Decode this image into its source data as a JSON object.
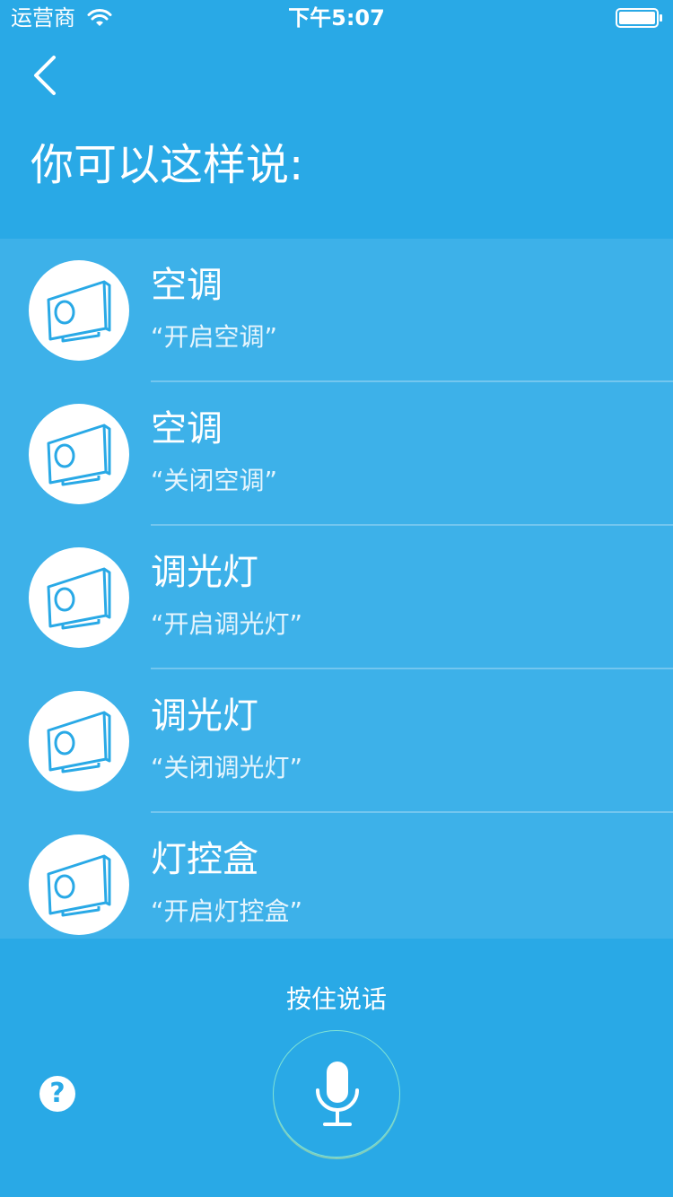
{
  "status_bar": {
    "carrier": "运营商",
    "time": "下午5:07"
  },
  "header": {
    "title": "你可以这样说:"
  },
  "commands": [
    {
      "device": "空调",
      "phrase": "“开启空调”",
      "icon": "device-box-icon"
    },
    {
      "device": "空调",
      "phrase": "“关闭空调”",
      "icon": "device-box-icon"
    },
    {
      "device": "调光灯",
      "phrase": "“开启调光灯”",
      "icon": "device-box-icon"
    },
    {
      "device": "调光灯",
      "phrase": "“关闭调光灯”",
      "icon": "device-box-icon"
    },
    {
      "device": "灯控盒",
      "phrase": "“开启灯控盒”",
      "icon": "device-box-icon"
    }
  ],
  "footer": {
    "hold_to_talk": "按住说话",
    "help_label": "?"
  },
  "colors": {
    "background": "#29a9e6",
    "list_background": "#3db1e9",
    "icon_stroke": "#29a9e6"
  }
}
